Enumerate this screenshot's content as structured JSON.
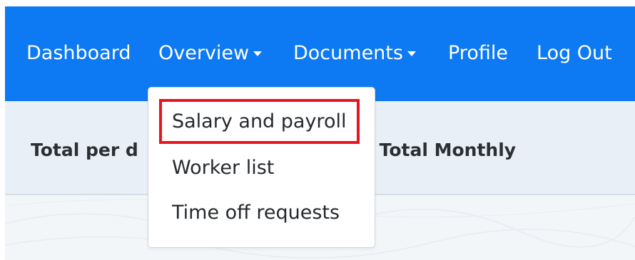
{
  "nav": {
    "dashboard": "Dashboard",
    "overview": "Overview",
    "documents": "Documents",
    "profile": "Profile",
    "logout": "Log Out"
  },
  "content": {
    "left_heading": "Total per d",
    "right_heading": "d Total Monthly"
  },
  "dropdown": {
    "items": [
      "Salary and payroll",
      "Worker list",
      "Time off requests"
    ],
    "highlighted_index": 0
  },
  "colors": {
    "navbar": "#0d79f2",
    "highlight": "#e8141f"
  },
  "icons": {
    "caret": "caret-down-icon"
  }
}
